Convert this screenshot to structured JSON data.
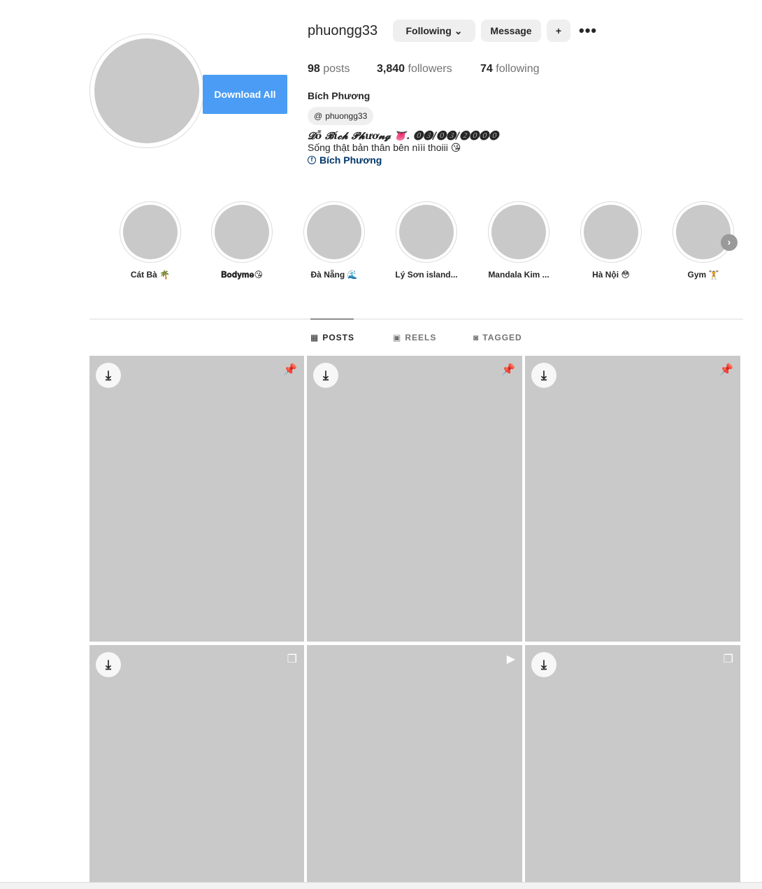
{
  "profile": {
    "username": "phuongg33",
    "following_label": "Following",
    "message_label": "Message",
    "more_label": "•••",
    "download_all_label": "Download All",
    "stats": {
      "posts": "98",
      "posts_label": "posts",
      "followers": "3,840",
      "followers_label": "followers",
      "following": "74",
      "following_label": "following"
    },
    "full_name": "Bích Phương",
    "threads_handle": "phuongg33",
    "bio_line1": "𝓓ỗ 𝓑í𝓬𝓱 𝓟𝓱ươ𝓷𝓰 👅. ⓿❸/⓿❸/❷⓿⓿⓿",
    "bio_line2": "Sống thật bản thân bên nììi thoiii 😘",
    "bio_link": "Bích Phương"
  },
  "highlights": [
    {
      "label": "Cát Bà 🌴"
    },
    {
      "label": "𝐁𝐨𝐝𝐲𝐦𝐞😘"
    },
    {
      "label": "Đà Nẵng 🌊"
    },
    {
      "label": "Lý Sơn island..."
    },
    {
      "label": "Mandala Kim ..."
    },
    {
      "label": "Hà Nội 😳"
    },
    {
      "label": "Gym 🏋"
    }
  ],
  "tabs": {
    "posts": "POSTS",
    "reels": "REELS",
    "tagged": "TAGGED"
  },
  "posts": [
    {
      "badge": "pin-icon"
    },
    {
      "badge": "pin-icon"
    },
    {
      "badge": "pin-icon"
    },
    {
      "badge": "carousel-icon"
    },
    {
      "badge": "reel-icon"
    },
    {
      "badge": "carousel-icon"
    }
  ],
  "colors": {
    "accent_button": "#4a9cf4",
    "link": "#00376b"
  }
}
